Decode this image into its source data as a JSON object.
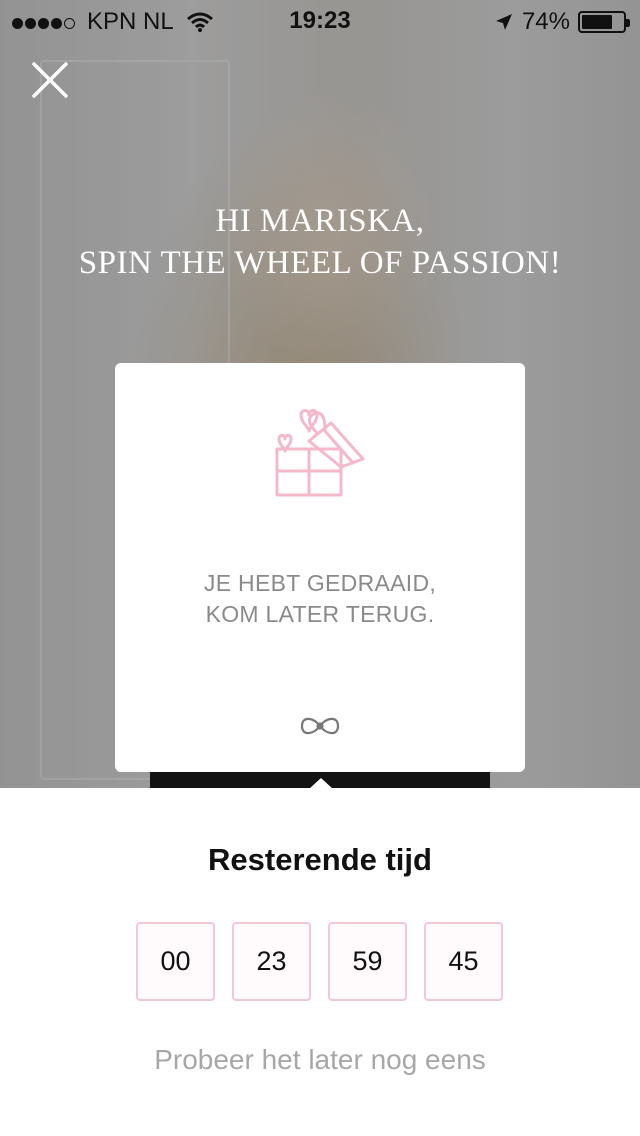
{
  "status_bar": {
    "carrier": "KPN NL",
    "time": "19:23",
    "battery": "74%",
    "battery_level": 0.74,
    "signal_bars": 4,
    "icons": [
      "signal-icon",
      "wifi-icon",
      "location-arrow-icon",
      "battery-icon"
    ]
  },
  "header": {
    "close_icon": "close-icon",
    "headline_line1": "HI MARISKA,",
    "headline_line2": "SPIN THE WHEEL OF PASSION!"
  },
  "card": {
    "icon": "gift-icon",
    "message_line1": "JE HEBT GEDRAAID,",
    "message_line2": "KOM LATER TERUG.",
    "footer_icon": "bow-icon"
  },
  "timer": {
    "title": "Resterende tijd",
    "values": [
      "00",
      "23",
      "59",
      "45"
    ],
    "retry": "Probeer het later nog eens"
  },
  "colors": {
    "accent_pink": "#f2c9d3",
    "icon_pink": "#f4b8c8",
    "muted_text": "#8a8a8a"
  }
}
